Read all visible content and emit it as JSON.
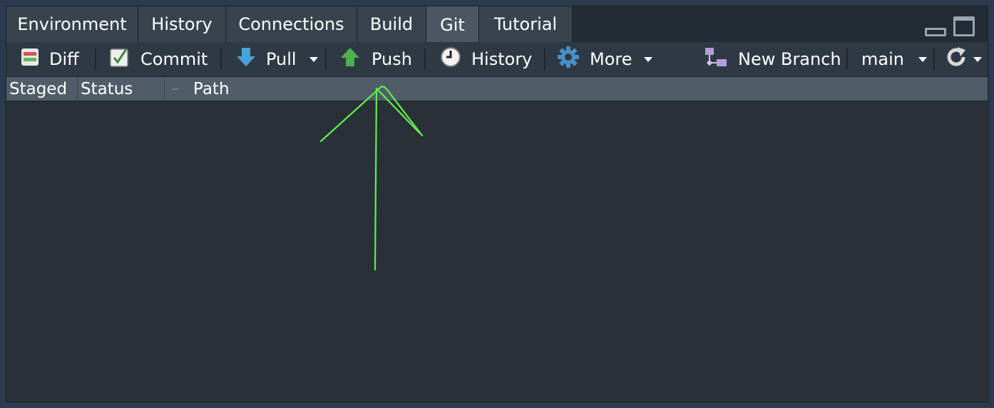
{
  "tabs": [
    {
      "label": "Environment"
    },
    {
      "label": "History"
    },
    {
      "label": "Connections"
    },
    {
      "label": "Build"
    },
    {
      "label": "Git"
    },
    {
      "label": "Tutorial"
    }
  ],
  "active_tab": "Git",
  "toolbar": {
    "diff": "Diff",
    "commit": "Commit",
    "pull": "Pull",
    "push": "Push",
    "history": "History",
    "more": "More",
    "new_branch": "New Branch",
    "branch": "main"
  },
  "columns": {
    "staged": "Staged",
    "status": "Status",
    "path": "Path"
  },
  "colors": {
    "annotation_arrow": "#5ef04a",
    "pull_icon": "#4aa3d8",
    "push_icon": "#4caf50"
  },
  "icons": [
    "diff-icon",
    "commit-icon",
    "pull-icon",
    "push-icon",
    "history-clock-icon",
    "gear-icon",
    "branch-icon",
    "refresh-icon"
  ]
}
